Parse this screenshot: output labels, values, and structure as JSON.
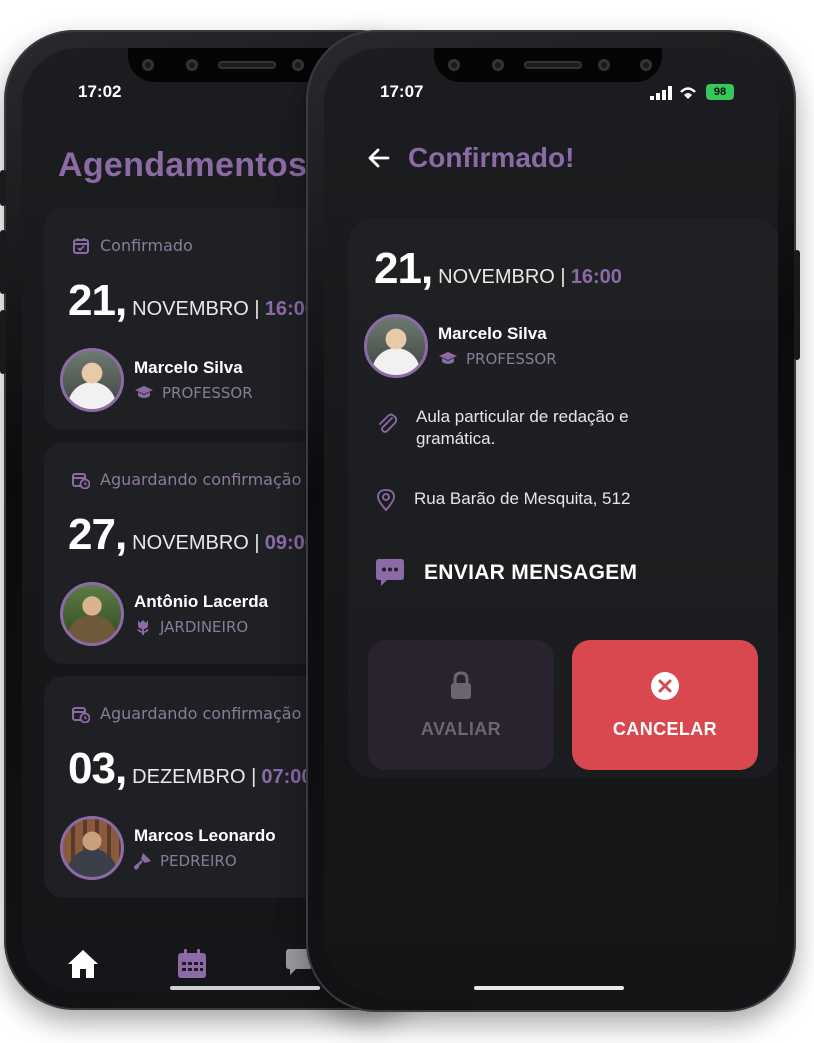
{
  "back_phone": {
    "status_bar": {
      "time": "17:02"
    },
    "page_title": "Agendamentos",
    "appointments": [
      {
        "status": "Confirmado",
        "day": "21,",
        "month": "NOVEMBRO |",
        "hour": "16:00",
        "name": "Marcelo Silva",
        "role": "PROFESSOR",
        "role_icon": "graduation-cap-icon"
      },
      {
        "status": "Aguardando confirmação",
        "day": "27,",
        "month": "NOVEMBRO |",
        "hour": "09:00",
        "name": "Antônio Lacerda",
        "role": "JARDINEIRO",
        "role_icon": "tulip-icon"
      },
      {
        "status": "Aguardando confirmação",
        "day": "03,",
        "month": "DEZEMBRO |",
        "hour": "07:00",
        "name": "Marcos Leonardo",
        "role": "PEDREIRO",
        "role_icon": "trowel-icon"
      }
    ],
    "tab_bar": {
      "items": [
        "home-icon",
        "calendar-icon",
        "chat-icon"
      ]
    }
  },
  "front_phone": {
    "status_bar": {
      "time": "17:07",
      "battery": "98"
    },
    "header": {
      "title": "Confirmado!"
    },
    "detail": {
      "day": "21,",
      "month": "NOVEMBRO |",
      "hour": "16:00",
      "name": "Marcelo Silva",
      "role": "PROFESSOR",
      "description": "Aula particular de redação e gramática.",
      "address": "Rua Barão de Mesquita, 512",
      "message_label": "ENVIAR MENSAGEM",
      "rate_label": "AVALIAR",
      "cancel_label": "CANCELAR"
    }
  },
  "colors": {
    "accent": "#8c6aa6",
    "danger": "#d9474f",
    "card": "#1f2024",
    "battery": "#34c759"
  }
}
